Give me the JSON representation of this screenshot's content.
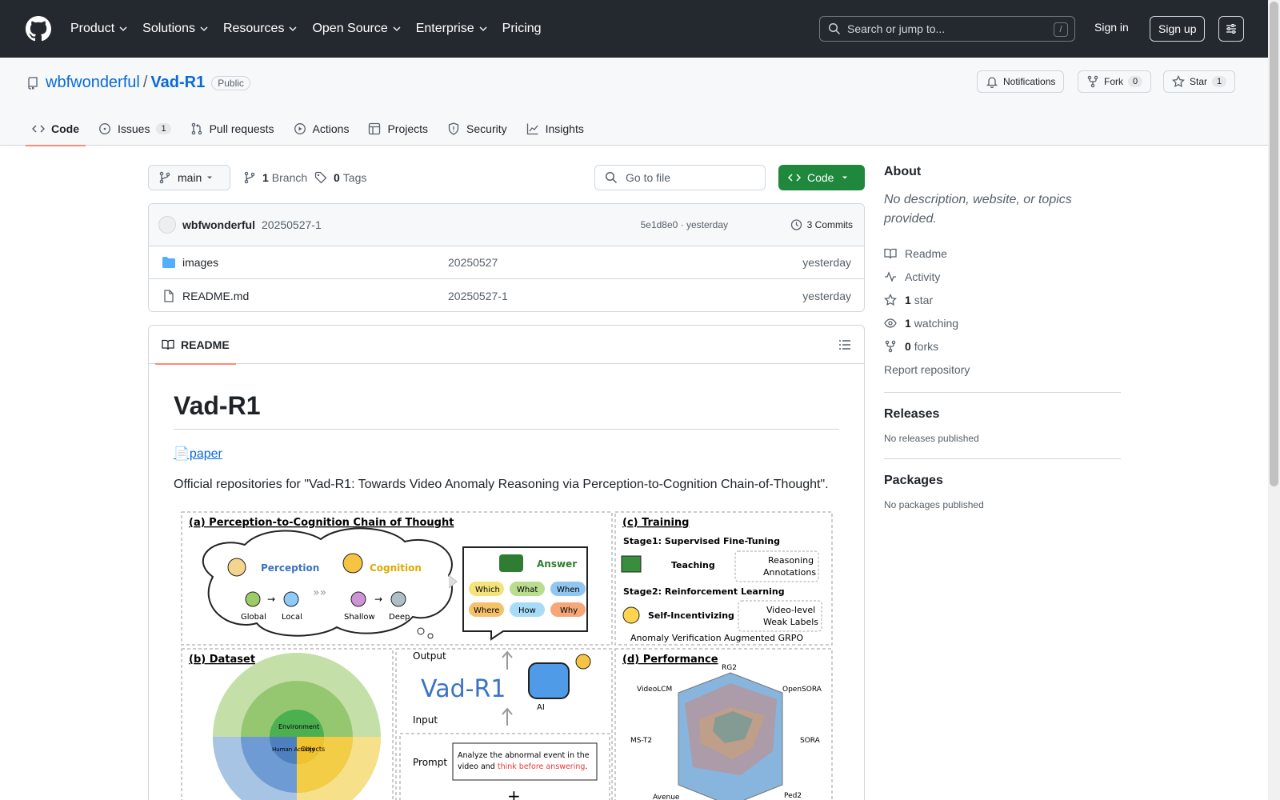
{
  "header": {
    "nav": [
      "Product",
      "Solutions",
      "Resources",
      "Open Source",
      "Enterprise",
      "Pricing"
    ],
    "search_placeholder": "Search or jump to...",
    "search_key": "/",
    "signin": "Sign in",
    "signup": "Sign up"
  },
  "repo": {
    "owner": "wbfwonderful",
    "separator": "/",
    "name": "Vad-R1",
    "visibility": "Public",
    "notifications": "Notifications",
    "fork_label": "Fork",
    "fork_count": "0",
    "star_label": "Star",
    "star_count": "1"
  },
  "tabs": [
    {
      "label": "Code"
    },
    {
      "label": "Issues",
      "count": "1"
    },
    {
      "label": "Pull requests"
    },
    {
      "label": "Actions"
    },
    {
      "label": "Projects"
    },
    {
      "label": "Security"
    },
    {
      "label": "Insights"
    }
  ],
  "files": {
    "branch": "main",
    "branch_count": "1",
    "branch_label": "Branch",
    "tag_count": "0",
    "tag_label": "Tags",
    "goto_placeholder": "Go to file",
    "code_button": "Code",
    "commit": {
      "author": "wbfwonderful",
      "message": "20250527-1",
      "hash": "5e1d8e0 · yesterday",
      "commits": "3 Commits"
    },
    "rows": [
      {
        "name": "images",
        "message": "20250527",
        "time": "yesterday"
      },
      {
        "name": "README.md",
        "message": "20250527-1",
        "time": "yesterday"
      }
    ]
  },
  "readme": {
    "tab": "README",
    "title": "Vad-R1",
    "paper_link": "📄paper",
    "description": "Official repositories for \"Vad-R1: Towards Video Anomaly Reasoning via Perception-to-Cognition Chain-of-Thought\".",
    "figure": {
      "panel_a_title": "(a) Perception-to-Cognition Chain of Thought",
      "perception": "Perception",
      "cognition": "Cognition",
      "global": "Global",
      "local": "Local",
      "shallow": "Shallow",
      "deep": "Deep",
      "answer": "Answer",
      "question_words": [
        "Which",
        "What",
        "When",
        "Where",
        "How",
        "Why"
      ],
      "panel_c_title": "(c) Training",
      "stage1": "Stage1: Supervised Fine-Tuning",
      "teaching": "Teaching",
      "reasoning_annotations_1": "Reasoning",
      "reasoning_annotations_2": "Annotations",
      "stage2": "Stage2: Reinforcement Learning",
      "self_incentivizing": "Self-Incentivizing",
      "weak_labels_1": "Video-level",
      "weak_labels_2": "Weak Labels",
      "grpo": "Anomaly Verification Augmented GRPO",
      "panel_b_title": "(b) Dataset",
      "dataset_inner": [
        "Environment",
        "Human Activity",
        "Objects"
      ],
      "output": "Output",
      "model_name": "Vad-R1",
      "ai": "AI",
      "input": "Input",
      "prompt": "Prompt",
      "prompt_text_1": "Analyze the abnormal event in the",
      "prompt_text_2a": "video and ",
      "prompt_text_2b": "think before answering",
      "prompt_text_2c": ".",
      "plus": "+",
      "panel_d_title": "(d) Performance",
      "radar_labels": [
        "RG2",
        "OpenSORA",
        "SORA",
        "Ped2",
        "Avenue",
        "MS-T2",
        "VideoLCM"
      ]
    }
  },
  "sidebar": {
    "about_title": "About",
    "about_desc": "No description, website, or topics provided.",
    "readme": "Readme",
    "activity": "Activity",
    "stars_count": "1",
    "stars_label": "star",
    "watching_count": "1",
    "watching_label": "watching",
    "forks_count": "0",
    "forks_label": "forks",
    "report": "Report repository",
    "releases_title": "Releases",
    "releases_none": "No releases published",
    "packages_title": "Packages",
    "packages_none": "No packages published"
  },
  "colors": {
    "header_bg": "#24292f",
    "link": "#0969da",
    "green": "#1f883d",
    "tab_underline": "#fd8c73"
  }
}
